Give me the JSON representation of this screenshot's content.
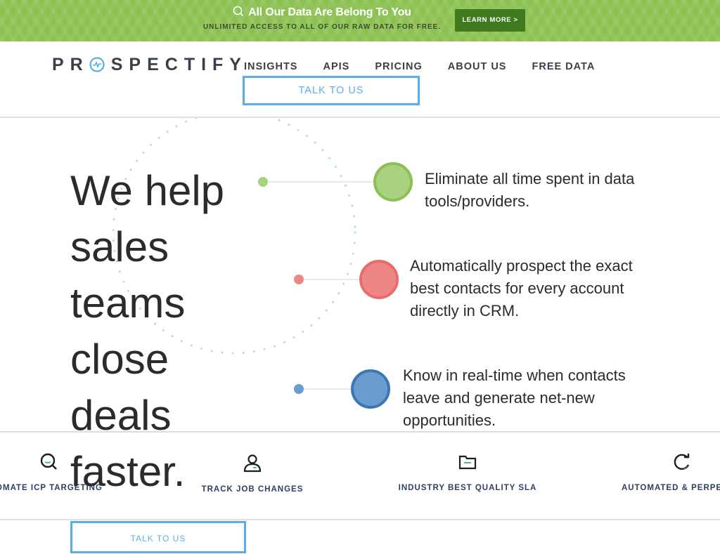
{
  "banner": {
    "title": "All Our Data Are Belong To You",
    "subtitle": "UNLIMITED ACCESS TO ALL OF OUR RAW DATA FOR FREE.",
    "button": "LEARN MORE >",
    "color": "#8cc152",
    "button_color": "#3f7a1f"
  },
  "header": {
    "logo_text": "PROSPECTIFY",
    "nav": [
      "INSIGHTS",
      "APIS",
      "PRICING",
      "ABOUT US",
      "FREE DATA"
    ],
    "cta": "TALK TO US",
    "accent": "#5aaee6"
  },
  "hero": {
    "headline_lines": [
      "We help",
      "sales",
      "teams",
      "close",
      "deals",
      "faster."
    ],
    "bullets": [
      {
        "text_lines": [
          "Eliminate all time spent in data",
          "tools/providers."
        ],
        "color": "#8cc152"
      },
      {
        "text_lines": [
          "Automatically prospect the exact",
          "best contacts for every account",
          "directly in CRM."
        ],
        "color": "#e86c6c"
      },
      {
        "text_lines": [
          "Know in real-time when contacts",
          "leave and generate net-new",
          "opportunities."
        ],
        "color": "#3a78b5"
      }
    ],
    "cta": "TALK TO US"
  },
  "features": [
    {
      "label": "OMATE ICP TARGETING",
      "icon": "search-icon"
    },
    {
      "label": "TRACK JOB CHANGES",
      "icon": "person-icon"
    },
    {
      "label": "INDUSTRY BEST QUALITY SLA",
      "icon": "folder-icon"
    },
    {
      "label": "AUTOMATED & PERPET",
      "icon": "refresh-icon"
    }
  ]
}
